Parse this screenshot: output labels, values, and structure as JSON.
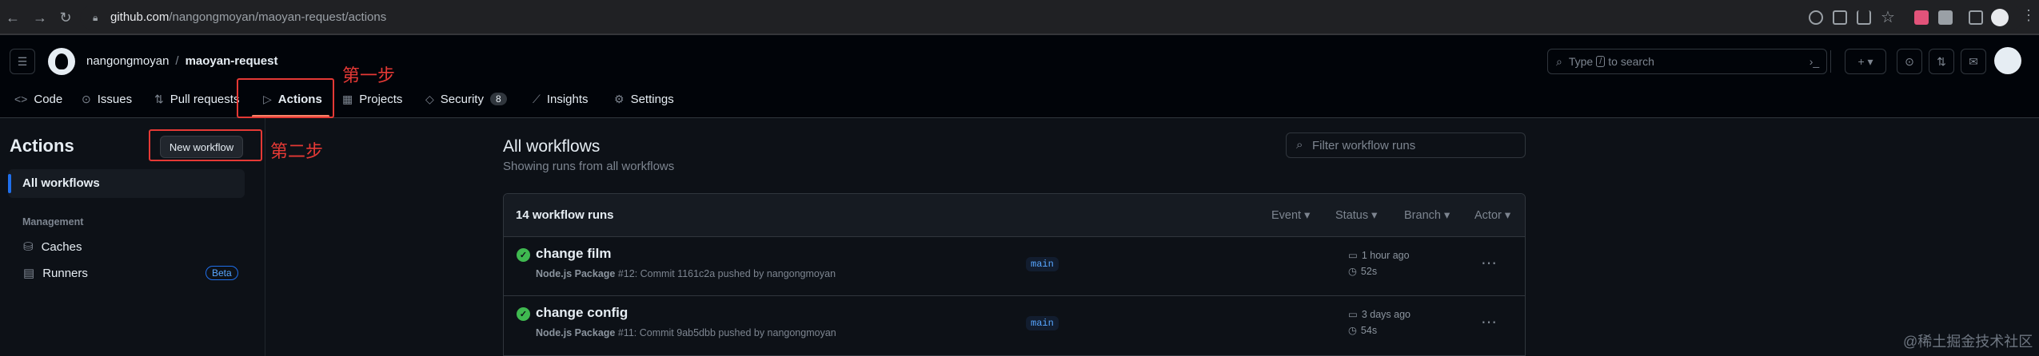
{
  "browser": {
    "url_host": "github.com",
    "url_path": "/nangongmoyan/maoyan-request/actions"
  },
  "repo": {
    "owner": "nangongmoyan",
    "separator": "/",
    "name": "maoyan-request"
  },
  "search": {
    "placeholder_pre": "Type",
    "key": "/",
    "placeholder_post": "to search"
  },
  "tabs": [
    {
      "label": "Code"
    },
    {
      "label": "Issues"
    },
    {
      "label": "Pull requests"
    },
    {
      "label": "Actions"
    },
    {
      "label": "Projects"
    },
    {
      "label": "Security",
      "count": "8"
    },
    {
      "label": "Insights"
    },
    {
      "label": "Settings"
    }
  ],
  "annotations": {
    "step1": "第一步",
    "step2": "第二步"
  },
  "sidebar": {
    "title": "Actions",
    "new_workflow": "New workflow",
    "all_workflows": "All workflows",
    "management_heading": "Management",
    "caches": "Caches",
    "runners": "Runners",
    "beta": "Beta"
  },
  "main": {
    "title": "All workflows",
    "subtitle": "Showing runs from all workflows",
    "filter_placeholder": "Filter workflow runs",
    "runs_count": "14 workflow runs",
    "filters": {
      "event": "Event",
      "status": "Status",
      "branch": "Branch",
      "actor": "Actor"
    },
    "runs": [
      {
        "title": "change film",
        "workflow": "Node.js Package",
        "meta": "#12: Commit 1161c2a pushed by nangongmoyan",
        "branch": "main",
        "time": "1 hour ago",
        "duration": "52s"
      },
      {
        "title": "change config",
        "workflow": "Node.js Package",
        "meta": "#11: Commit 9ab5dbb pushed by nangongmoyan",
        "branch": "main",
        "time": "3 days ago",
        "duration": "54s"
      }
    ]
  },
  "watermark": "@稀土掘金技术社区",
  "colors": {
    "accent": "#f78166",
    "annotation": "#e53935",
    "success": "#3fb950",
    "link": "#58a6ff"
  }
}
